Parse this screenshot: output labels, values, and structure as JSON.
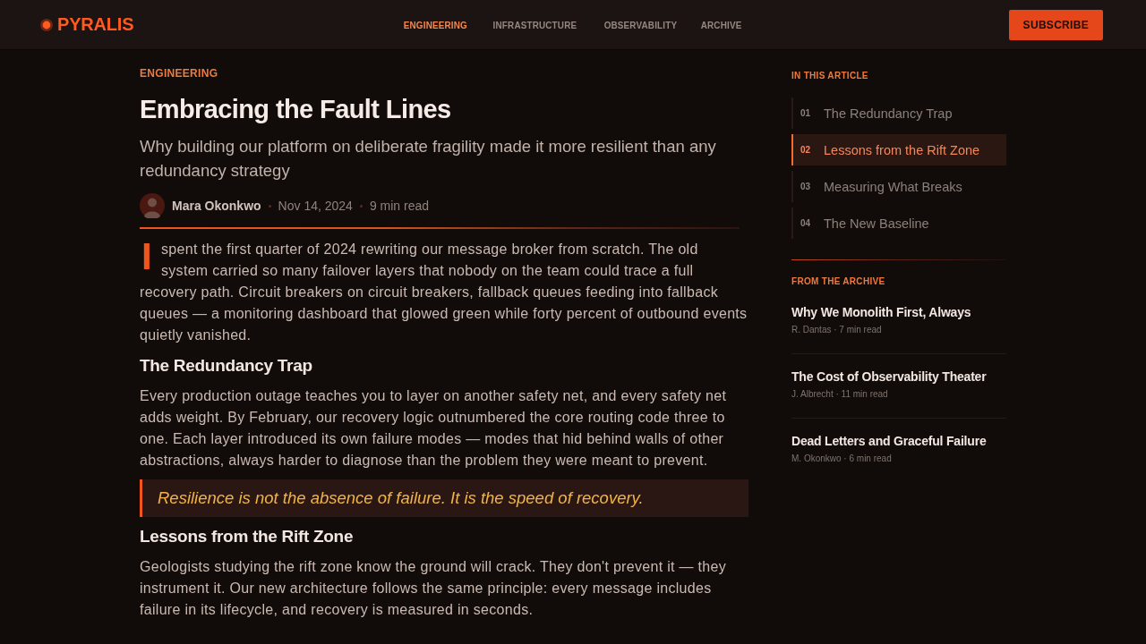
{
  "header": {
    "logo": "PYRALIS",
    "nav": [
      {
        "label": "ENGINEERING",
        "selected": true
      },
      {
        "label": "INFRASTRUCTURE",
        "selected": false
      },
      {
        "label": "OBSERVABILITY",
        "selected": false
      },
      {
        "label": "ARCHIVE",
        "selected": false
      }
    ],
    "subscribe_button": "SUBSCRIBE"
  },
  "article": {
    "category": "ENGINEERING",
    "title": "Embracing the Fault Lines",
    "subtitle": "Why building our platform on deliberate fragility made it more resilient than any redundancy strategy",
    "author": "Mara Okonkwo",
    "date": "Nov 14, 2024",
    "read_time": "9 min read",
    "body": [
      {
        "kind": "paragraph",
        "drop_cap": true,
        "text": "I spent the first quarter of 2024 rewriting our message broker from scratch. The old system carried so many failover layers that nobody on the team could trace a full recovery path. Circuit breakers on circuit breakers, fallback queues feeding into fallback queues — a monitoring dashboard that glowed green while forty percent of outbound events quietly vanished."
      },
      {
        "kind": "heading",
        "text": "The Redundancy Trap"
      },
      {
        "kind": "paragraph",
        "drop_cap": false,
        "text": "Every production outage teaches you to layer on another safety net, and every safety net adds weight. By February, our recovery logic outnumbered the core routing code three to one. Each layer introduced its own failure modes — modes that hid behind walls of other abstractions, always harder to diagnose than the problem they were meant to prevent."
      },
      {
        "kind": "quote",
        "text": "Resilience is not the absence of failure. It is the speed of recovery."
      },
      {
        "kind": "heading",
        "text": "Lessons from the Rift Zone"
      },
      {
        "kind": "paragraph",
        "drop_cap": false,
        "text": "Geologists studying the rift zone know the ground will crack. They don't prevent it — they instrument it. Our new architecture follows the same principle: every message includes failure in its lifecycle, and recovery is measured in seconds."
      }
    ]
  },
  "sidebar": {
    "toc_title": "IN THIS ARTICLE",
    "toc": [
      {
        "number": "01",
        "label": "The Redundancy Trap",
        "selected": false
      },
      {
        "number": "02",
        "label": "Lessons from the Rift Zone",
        "selected": true
      },
      {
        "number": "03",
        "label": "Measuring What Breaks",
        "selected": false
      },
      {
        "number": "04",
        "label": "The New Baseline",
        "selected": false
      }
    ],
    "archive_title": "FROM THE ARCHIVE",
    "archive": [
      {
        "title": "Why We Monolith First, Always",
        "meta": "R. Dantas · 7 min read"
      },
      {
        "title": "The Cost of Observability Theater",
        "meta": "J. Albrecht · 11 min read"
      },
      {
        "title": "Dead Letters and Graceful Failure",
        "meta": "M. Okonkwo · 6 min read"
      }
    ]
  }
}
